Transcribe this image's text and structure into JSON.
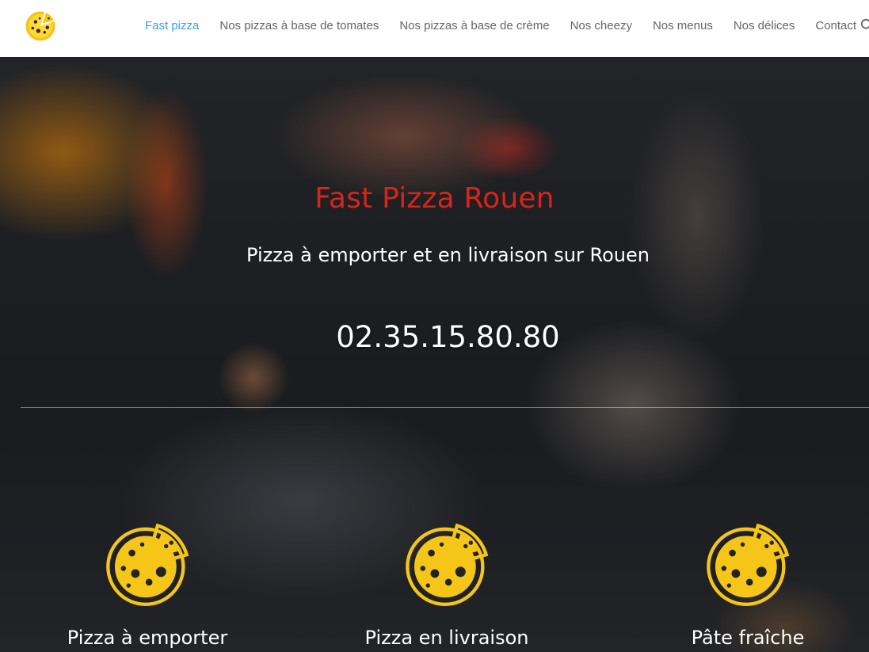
{
  "nav": {
    "items": [
      {
        "label": "Fast pizza",
        "active": true
      },
      {
        "label": "Nos pizzas à base de tomates",
        "active": false
      },
      {
        "label": "Nos pizzas à base de crème",
        "active": false
      },
      {
        "label": "Nos cheezy",
        "active": false
      },
      {
        "label": "Nos menus",
        "active": false
      },
      {
        "label": "Nos délices",
        "active": false
      },
      {
        "label": "Contact",
        "active": false
      }
    ]
  },
  "hero": {
    "title": "Fast Pizza Rouen",
    "subtitle": "Pizza à emporter et en livraison sur Rouen",
    "phone": "02.35.15.80.80"
  },
  "features": [
    {
      "label": "Pizza à emporter",
      "icon": "pizza-icon"
    },
    {
      "label": "Pizza en livraison",
      "icon": "pizza-icon"
    },
    {
      "label": "Pâte fraîche",
      "icon": "pizza-icon"
    }
  ],
  "colors": {
    "accent": "#2ea3f2",
    "title_red": "#d8241a",
    "pizza_yellow": "#f5c518",
    "header_bg": "#ffffff"
  }
}
